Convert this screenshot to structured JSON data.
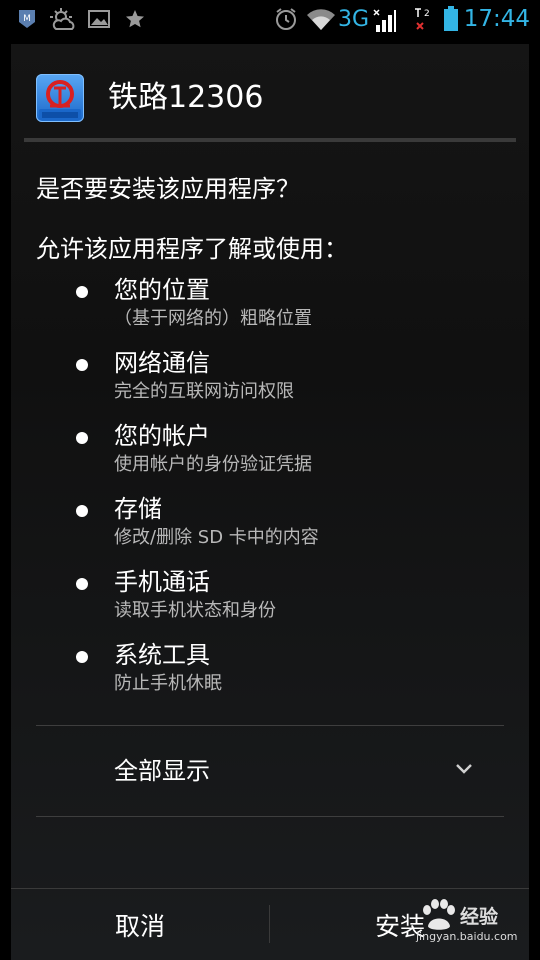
{
  "status_bar": {
    "network": "3G",
    "time": "17:44",
    "icons": [
      "app-m-icon",
      "weather-icon",
      "gallery-icon",
      "star-icon",
      "alarm-icon",
      "wifi-icon",
      "signal-icon",
      "sim2-signal-icon",
      "battery-icon"
    ]
  },
  "dialog": {
    "app_name": "铁路12306",
    "question": "是否要安装该应用程序？",
    "allow_heading": "允许该应用程序了解或使用："
  },
  "permissions": [
    {
      "title": "您的位置",
      "desc": "（基于网络的）粗略位置"
    },
    {
      "title": "网络通信",
      "desc": "完全的互联网访问权限"
    },
    {
      "title": "您的帐户",
      "desc": "使用帐户的身份验证凭据"
    },
    {
      "title": "存储",
      "desc": "修改/删除 SD 卡中的内容"
    },
    {
      "title": "手机通话",
      "desc": "读取手机状态和身份"
    },
    {
      "title": "系统工具",
      "desc": "防止手机休眠"
    }
  ],
  "show_all": {
    "label": "全部显示"
  },
  "buttons": {
    "cancel": "取消",
    "install": "安装"
  },
  "watermark": {
    "brand": "经验",
    "url": "jingyan.baidu.com"
  },
  "colors": {
    "accent": "#33b5e5",
    "background": "#000000"
  }
}
